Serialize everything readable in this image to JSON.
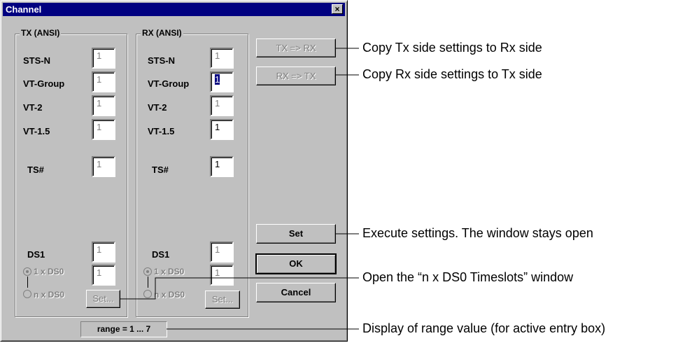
{
  "window": {
    "title": "Channel",
    "close_glyph": "×"
  },
  "tx": {
    "title": "TX (ANSI)",
    "labels": {
      "sts_n": "STS-N",
      "vt_group": "VT-Group",
      "vt2": "VT-2",
      "vt15": "VT-1.5",
      "ts": "TS#",
      "ds1": "DS1"
    },
    "values": {
      "sts_n": "1",
      "vt_group": "1",
      "vt2": "1",
      "vt15": "1",
      "ts": "1",
      "ds1": "1",
      "ds0": "1"
    },
    "radio_1ds0": "1 x DS0",
    "radio_nds0": "n x DS0",
    "set_label": "Set..."
  },
  "rx": {
    "title": "RX (ANSI)",
    "labels": {
      "sts_n": "STS-N",
      "vt_group": "VT-Group",
      "vt2": "VT-2",
      "vt15": "VT-1.5",
      "ts": "TS#",
      "ds1": "DS1"
    },
    "values": {
      "sts_n": "1",
      "vt_group": "1",
      "vt2": "1",
      "vt15": "1",
      "ts": "1",
      "ds1": "1",
      "ds0": "1"
    },
    "radio_1ds0": "1 x DS0",
    "radio_nds0": "n x DS0",
    "set_label": "Set..."
  },
  "buttons": {
    "tx_to_rx": "TX => RX",
    "rx_to_tx": "RX => TX",
    "set": "Set",
    "ok": "OK",
    "cancel": "Cancel"
  },
  "status": {
    "range": "range = 1 ... 7"
  },
  "callouts": {
    "copy_tx": "Copy Tx side settings to Rx side",
    "copy_rx": "Copy Rx side settings to Tx side",
    "execute": "Execute settings. The window stays open",
    "open_ds0": "Open the “n x DS0 Timeslots” window",
    "range_display": "Display of range value (for active entry box)"
  }
}
